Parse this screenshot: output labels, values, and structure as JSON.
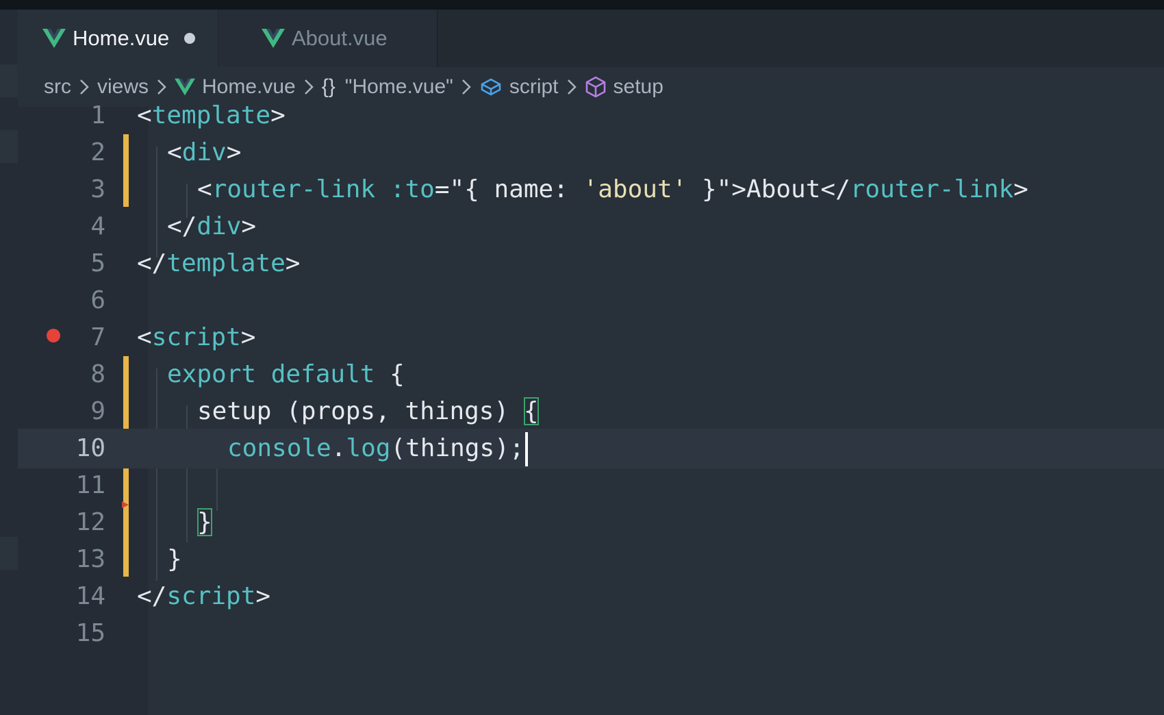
{
  "tabs": [
    {
      "label": "Home.vue",
      "active": true,
      "modified": true
    },
    {
      "label": "About.vue",
      "active": false,
      "modified": false
    }
  ],
  "breadcrumb": {
    "items": [
      "src",
      "views",
      "Home.vue",
      "\"Home.vue\"",
      "script",
      "setup"
    ],
    "braces": "{}"
  },
  "editor": {
    "line_numbers": [
      "1",
      "2",
      "3",
      "4",
      "5",
      "6",
      "7",
      "8",
      "9",
      "10",
      "11",
      "12",
      "13",
      "14",
      "15"
    ],
    "current_line": "10",
    "breakpoint_line": "7",
    "tokens": {
      "lt": "<",
      "gt": ">",
      "lt_slash": "</",
      "template": "template",
      "div": "div",
      "router_link": "router-link",
      "to_attr": ":to",
      "eq_quote_open": "=\"{ name: ",
      "about_string": "'about'",
      "close_brace_quote": " }\"",
      "about_text": "About",
      "script": "script",
      "export": "export",
      "default": "default",
      "open_brace": "{",
      "setup_fn": "setup",
      "params": " (props, things) ",
      "console": "console",
      "dot": ".",
      "log": "log",
      "log_args": "(things);",
      "close_brace": "}"
    }
  },
  "colors": {
    "vue_green": "#41b883",
    "vue_dark": "#34495e",
    "git_modified": "#e8b548",
    "breakpoint": "#e5423a",
    "accent_teal": "#56c1c4"
  }
}
